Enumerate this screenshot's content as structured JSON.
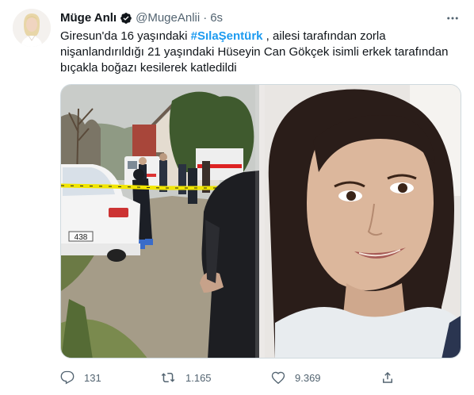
{
  "tweet": {
    "author_name": "Müge Anlı",
    "handle": "@MugeAnlii",
    "separator": "·",
    "time": "6s",
    "text_part1": "Giresun'da 16 yaşındaki ",
    "hashtag": "#SılaŞentürk",
    "text_part2": " , ailesi tarafından zorla nişanlandırıldığı 21 yaşındaki Hüseyin Can Gökçek isimli erkek tarafından bıçakla boğazı kesilerek katledildi",
    "plate_text": "438",
    "icons": {
      "verified": "verified-badge-icon",
      "more": "more-icon",
      "reply": "reply-icon",
      "retweet": "retweet-icon",
      "like": "like-icon",
      "share": "share-icon"
    },
    "actions": {
      "reply_count": "131",
      "retweet_count": "1.165",
      "like_count": "9.369"
    },
    "colors": {
      "hashtag": "#1d9bf0",
      "secondary_text": "#536471",
      "police_tape": "#f2e600"
    }
  }
}
